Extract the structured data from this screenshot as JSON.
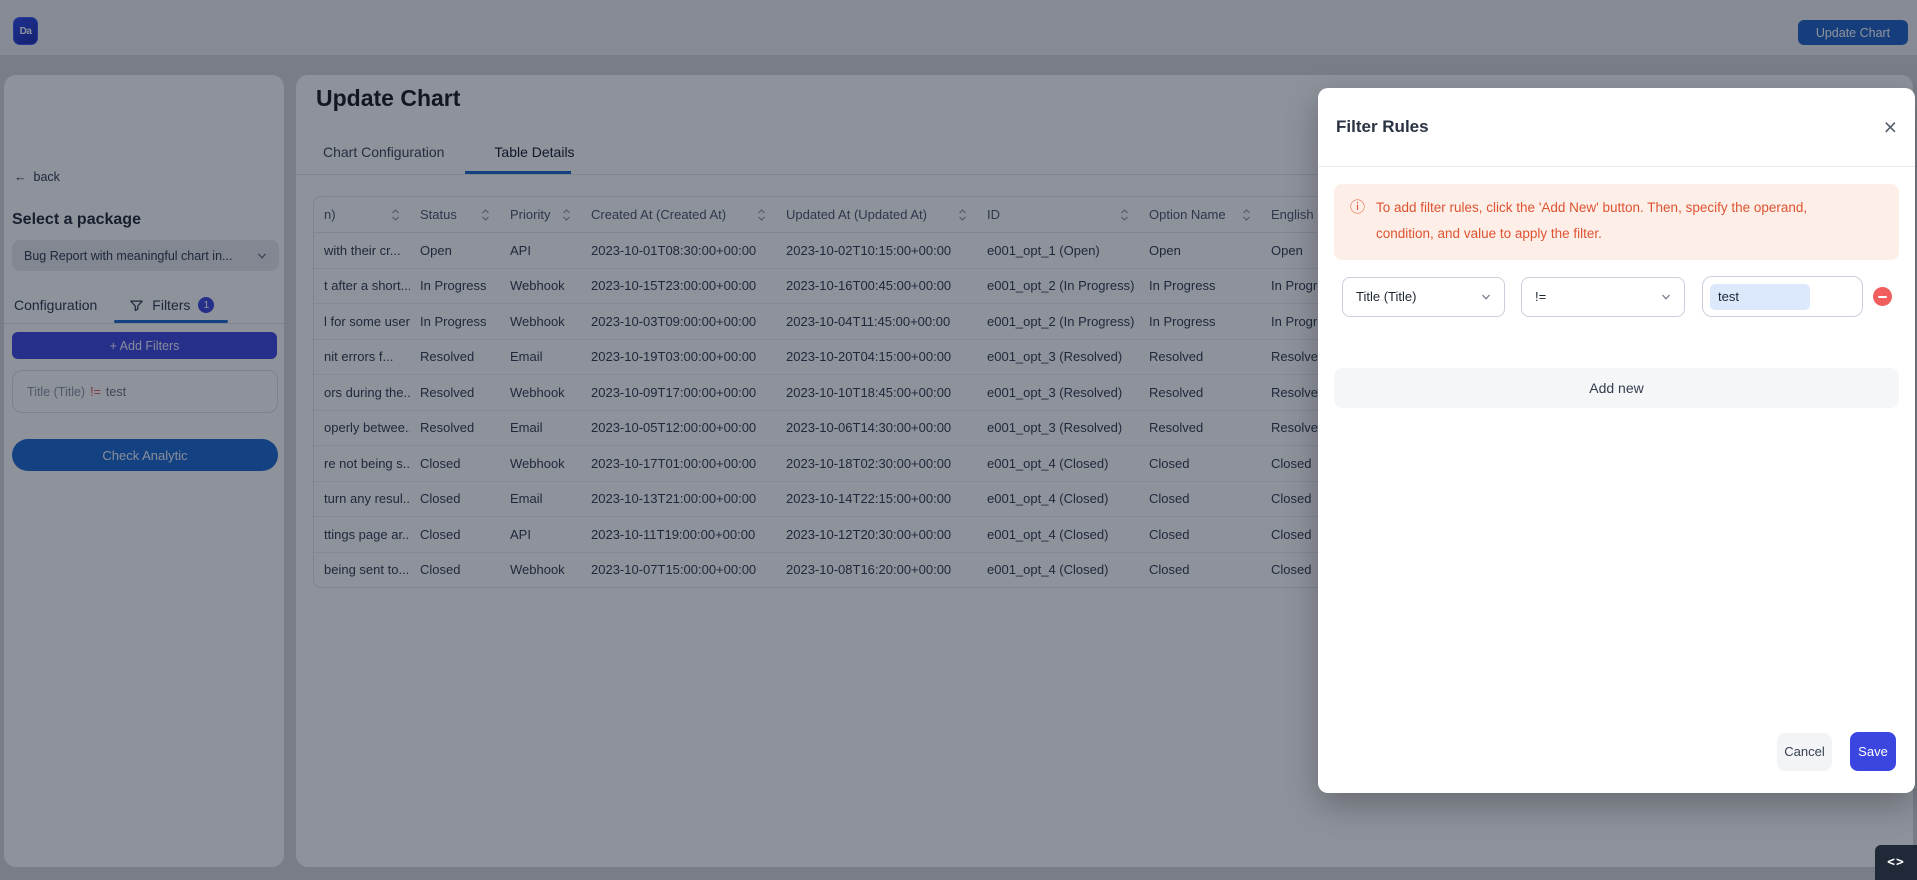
{
  "topbar": {
    "logo_text": "Da",
    "update_chart_button": "Update Chart"
  },
  "sidebar": {
    "back_label": "back",
    "back_arrow": "←",
    "select_package_label": "Select a package",
    "package_dropdown_value": "Bug Report with meaningful chart in...",
    "tabs": {
      "configuration": "Configuration",
      "filters": "Filters",
      "filters_badge": "1"
    },
    "add_filters_button": "+ Add Filters",
    "filter_chip": {
      "field": "Title (Title)",
      "operator": "!=",
      "value": "test"
    },
    "check_analytic_button": "Check Analytic"
  },
  "main": {
    "title": "Update Chart",
    "tabs": [
      {
        "label": "Chart Configuration"
      },
      {
        "label": "Table Details"
      }
    ],
    "active_tab": "Table Details"
  },
  "table": {
    "columns": [
      "n)",
      "Status",
      "Priority",
      "Created At (Created At)",
      "Updated At (Updated At)",
      "ID",
      "Option Name",
      "English"
    ],
    "rows": [
      [
        "with their cr...",
        "Open",
        "API",
        "2023-10-01T08:30:00+00:00",
        "2023-10-02T10:15:00+00:00",
        "e001_opt_1 (Open)",
        "Open",
        "Open"
      ],
      [
        "t after a short...",
        "In Progress",
        "Webhook",
        "2023-10-15T23:00:00+00:00",
        "2023-10-16T00:45:00+00:00",
        "e001_opt_2 (In Progress)",
        "In Progress",
        "In Progress"
      ],
      [
        "l for some user...",
        "In Progress",
        "Webhook",
        "2023-10-03T09:00:00+00:00",
        "2023-10-04T11:45:00+00:00",
        "e001_opt_2 (In Progress)",
        "In Progress",
        "In Progress"
      ],
      [
        "nit errors f...",
        "Resolved",
        "Email",
        "2023-10-19T03:00:00+00:00",
        "2023-10-20T04:15:00+00:00",
        "e001_opt_3 (Resolved)",
        "Resolved",
        "Resolved"
      ],
      [
        "ors during the...",
        "Resolved",
        "Webhook",
        "2023-10-09T17:00:00+00:00",
        "2023-10-10T18:45:00+00:00",
        "e001_opt_3 (Resolved)",
        "Resolved",
        "Resolved"
      ],
      [
        "operly betwee...",
        "Resolved",
        "Email",
        "2023-10-05T12:00:00+00:00",
        "2023-10-06T14:30:00+00:00",
        "e001_opt_3 (Resolved)",
        "Resolved",
        "Resolved"
      ],
      [
        "re not being s...",
        "Closed",
        "Webhook",
        "2023-10-17T01:00:00+00:00",
        "2023-10-18T02:30:00+00:00",
        "e001_opt_4 (Closed)",
        "Closed",
        "Closed"
      ],
      [
        "turn any resul...",
        "Closed",
        "Email",
        "2023-10-13T21:00:00+00:00",
        "2023-10-14T22:15:00+00:00",
        "e001_opt_4 (Closed)",
        "Closed",
        "Closed"
      ],
      [
        "ttings page ar...",
        "Closed",
        "API",
        "2023-10-11T19:00:00+00:00",
        "2023-10-12T20:30:00+00:00",
        "e001_opt_4 (Closed)",
        "Closed",
        "Closed"
      ],
      [
        "being sent to...",
        "Closed",
        "Webhook",
        "2023-10-07T15:00:00+00:00",
        "2023-10-08T16:20:00+00:00",
        "e001_opt_4 (Closed)",
        "Closed",
        "Closed"
      ]
    ]
  },
  "modal": {
    "title": "Filter Rules",
    "close_icon": "×",
    "info_icon": "ⓘ",
    "info_text": "To add filter rules, click the 'Add New' button. Then, specify the operand, condition, and value to apply the filter.",
    "rule": {
      "operand": "Title (Title)",
      "condition": "!=",
      "value": "test"
    },
    "add_new_button": "Add new",
    "cancel_button": "Cancel",
    "save_button": "Save"
  },
  "corner": {
    "code_icon": "<>"
  },
  "colors": {
    "accent_indigo": "#3b45df",
    "accent_blue": "#1a66cf",
    "tab_underline": "#1765cf",
    "warning_text": "#dd5433",
    "warning_bg": "#fdeee7",
    "remove_red": "#f05e5e",
    "operator_red": "#e05252"
  }
}
